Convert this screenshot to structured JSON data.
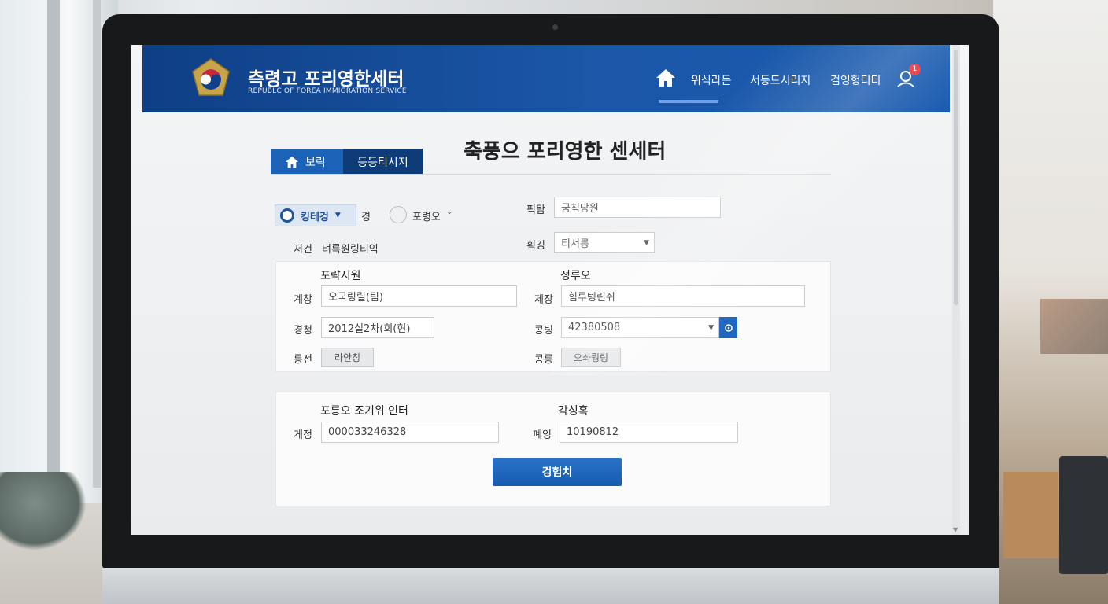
{
  "header": {
    "title": "측령고 포리영한세터",
    "subtitle": "REPUBLC OF FOREA IMMIGRATION SERVICE",
    "nav": [
      "위식라든",
      "서등드시리지",
      "검잉헝티티"
    ],
    "notification_count": "1"
  },
  "tabs": {
    "home_label": "보릭",
    "register_label": "등등티시지"
  },
  "page_title": "축풍으 포리영한 센세터",
  "id_type": {
    "chip_label": "킹테겅",
    "chip_suffix": "경",
    "radio_label": "포령오",
    "row_label": "저건",
    "row_value": "텨륵원링티익"
  },
  "top_fields": {
    "field1_label": "픽탐",
    "field1_value": "궁칙당원",
    "field2_label": "획깅",
    "field2_value": "티서릉"
  },
  "section1": {
    "left_heading": "포략시원",
    "right_heading": "정루오",
    "row1": {
      "left_label": "계창",
      "left_value": "오국링릴(팀)",
      "right_label": "제장",
      "right_value": "힘루텡린쥐"
    },
    "row2": {
      "left_label": "경청",
      "left_value": "2012실2차(희(현)",
      "right_label": "콩팅",
      "right_value": "42380508"
    },
    "row3": {
      "left_label": "릉전",
      "left_button": "라안칭",
      "right_label": "콩릉",
      "right_button": "오솨뤙링"
    }
  },
  "section2": {
    "left_heading": "포릉오 조기위 인터",
    "right_heading": "각싱혹",
    "left_label": "게정",
    "left_value": "000033246328",
    "right_label": "폐잉",
    "right_value": "10190812"
  },
  "submit_label": "겅험치",
  "colors": {
    "primary": "#1b56a7",
    "nav_dark": "#0d3c79",
    "badge": "#e2323d"
  }
}
